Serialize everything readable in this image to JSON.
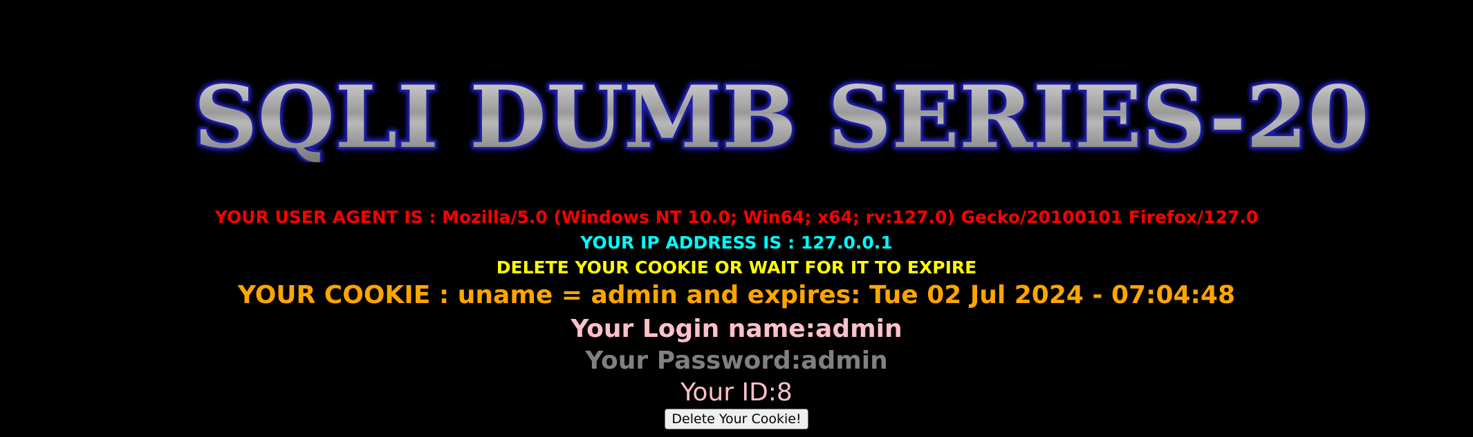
{
  "banner": {
    "title": "SQLI DUMB SERIES-20"
  },
  "info": {
    "user_agent": "YOUR USER AGENT IS : Mozilla/5.0 (Windows NT 10.0; Win64; x64; rv:127.0) Gecko/20100101 Firefox/127.0",
    "ip_address": "YOUR IP ADDRESS IS : 127.0.0.1",
    "delete_notice": "DELETE YOUR COOKIE OR WAIT FOR IT TO EXPIRE",
    "cookie": "YOUR COOKIE : uname = admin and expires: Tue 02 Jul 2024 - 07:04:48",
    "login_name": "Your Login name:admin",
    "password": "Your Password:admin",
    "user_id": "Your ID:8"
  },
  "actions": {
    "delete_cookie_label": "Delete Your Cookie!"
  },
  "colors": {
    "background": "#000000",
    "user_agent": "#ff0000",
    "ip_address": "#00ffff",
    "delete_notice": "#ffff00",
    "cookie": "#ffa500",
    "login_name": "#ffc0cb",
    "password": "#808080",
    "user_id": "#ffc0cb"
  }
}
